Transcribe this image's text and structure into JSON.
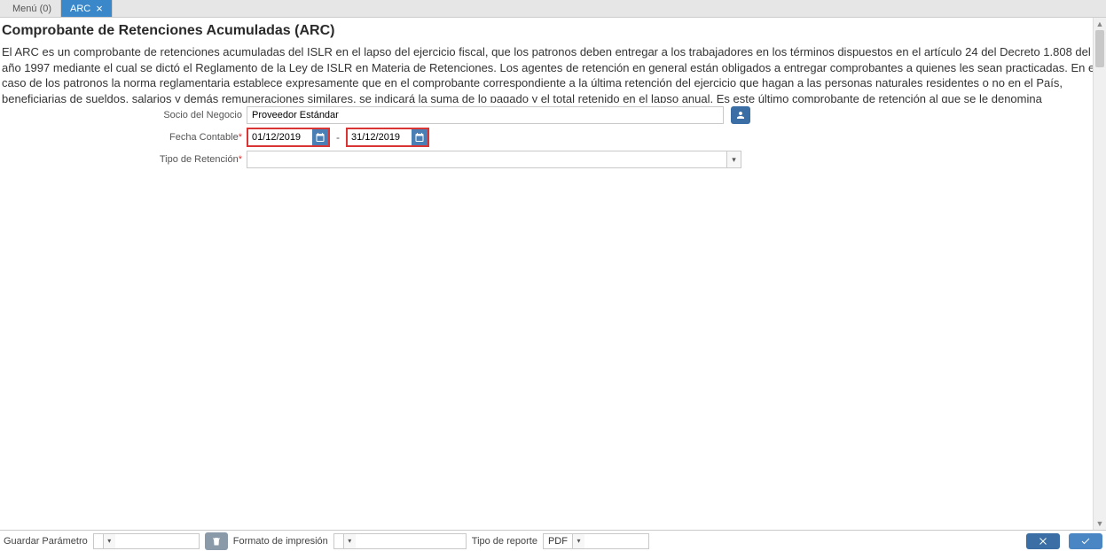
{
  "tabs": {
    "menu": "Menú (0)",
    "active": "ARC"
  },
  "header": {
    "title": "Comprobante de Retenciones Acumuladas (ARC)",
    "description": "El ARC es un comprobante de retenciones acumuladas del ISLR en el lapso del ejercicio fiscal, que los patronos deben entregar a los trabajadores en los términos dispuestos en el artículo 24 del Decreto 1.808 del año 1997 mediante el cual se dictó el Reglamento de la Ley de ISLR en Materia de Retenciones. Los agentes de retención en general están obligados a entregar comprobantes a quienes les sean practicadas. En el caso de los patronos la norma reglamentaria establece expresamente que en el comprobante correspondiente a la última retención del ejercicio que hagan a las personas naturales residentes o no en el País, beneficiarias de sueldos, salarios y demás remuneraciones similares, se indicará la suma de lo pagado y el total retenido en el lapso anual. Es este último comprobante de retención al que se le denomina"
  },
  "form": {
    "business_partner_label": "Socio del Negocio",
    "business_partner_value": "Proveedor Estándar",
    "accounting_date_label": "Fecha Contable",
    "date_from": "01/12/2019",
    "date_to": "31/12/2019",
    "retention_type_label": "Tipo de Retención",
    "retention_type_value": ""
  },
  "footer": {
    "save_param_label": "Guardar Parámetro",
    "save_param_value": "",
    "print_format_label": "Formato de impresión",
    "print_format_value": "",
    "report_type_label": "Tipo de reporte",
    "report_type_value": "PDF"
  }
}
